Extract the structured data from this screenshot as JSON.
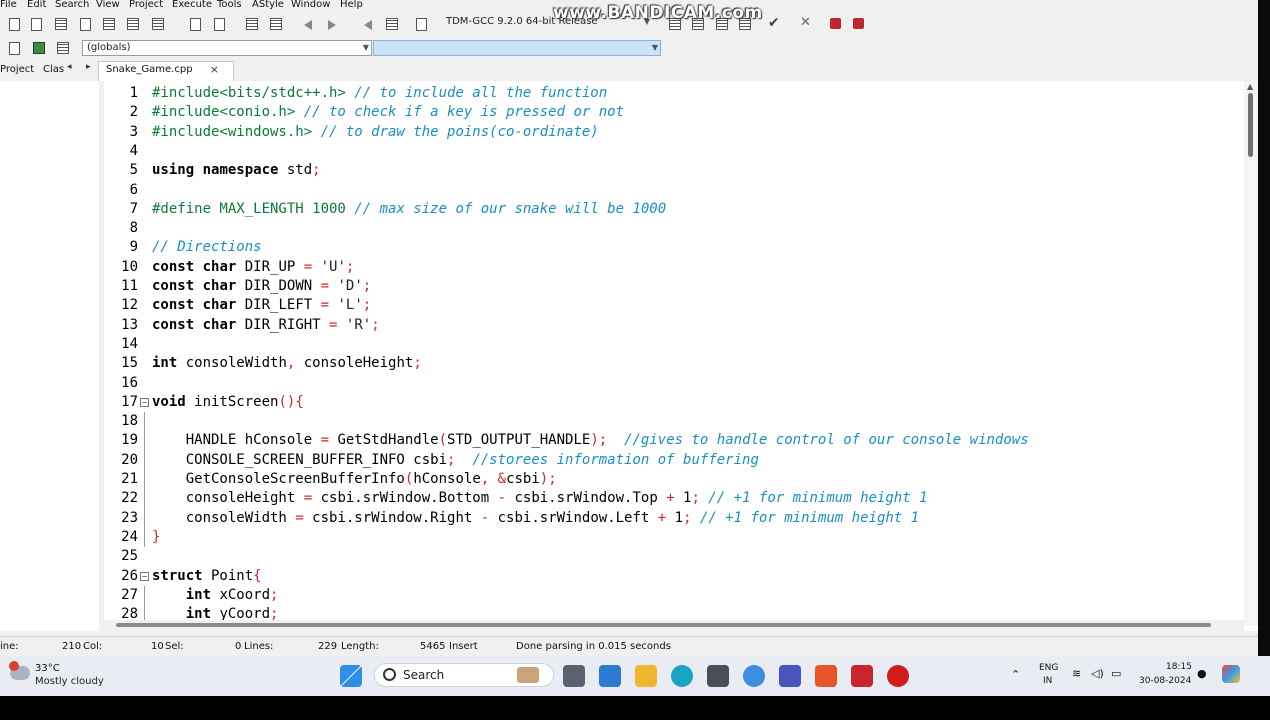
{
  "menu": [
    "File",
    "Edit",
    "Search",
    "View",
    "Project",
    "Execute",
    "Tools",
    "AStyle",
    "Window",
    "Help"
  ],
  "toolbar": {
    "compiler": "TDM-GCC 9.2.0 64-bit Release",
    "scope": "(globals)",
    "watermark": "www.BANDICAM.com"
  },
  "panel_tabs": {
    "project": "Project",
    "classes": "Clas"
  },
  "file_tab": {
    "name": "Snake_Game.cpp",
    "close": "×"
  },
  "editor": {
    "lines": [
      {
        "n": "1",
        "text": "#include<bits/stdc++.h> // to include all the function"
      },
      {
        "n": "2",
        "text": "#include<conio.h> // to check if a key is pressed or not"
      },
      {
        "n": "3",
        "text": "#include<windows.h> // to draw the poins(co-ordinate)"
      },
      {
        "n": "4",
        "text": ""
      },
      {
        "n": "5",
        "text": "using namespace std;"
      },
      {
        "n": "6",
        "text": ""
      },
      {
        "n": "7",
        "text": "#define MAX_LENGTH 1000 // max size of our snake will be 1000"
      },
      {
        "n": "8",
        "text": ""
      },
      {
        "n": "9",
        "text": "// Directions"
      },
      {
        "n": "10",
        "text": "const char DIR_UP = 'U';"
      },
      {
        "n": "11",
        "text": "const char DIR_DOWN = 'D';"
      },
      {
        "n": "12",
        "text": "const char DIR_LEFT = 'L';"
      },
      {
        "n": "13",
        "text": "const char DIR_RIGHT = 'R';"
      },
      {
        "n": "14",
        "text": ""
      },
      {
        "n": "15",
        "text": "int consoleWidth, consoleHeight;"
      },
      {
        "n": "16",
        "text": ""
      },
      {
        "n": "17",
        "text": "void initScreen(){"
      },
      {
        "n": "18",
        "text": ""
      },
      {
        "n": "19",
        "text": "    HANDLE hConsole = GetStdHandle(STD_OUTPUT_HANDLE);  //gives to handle control of our console windows"
      },
      {
        "n": "20",
        "text": "    CONSOLE_SCREEN_BUFFER_INFO csbi;  //storees information of buffering"
      },
      {
        "n": "21",
        "text": "    GetConsoleScreenBufferInfo(hConsole, &csbi);"
      },
      {
        "n": "22",
        "text": "    consoleHeight = csbi.srWindow.Bottom - csbi.srWindow.Top + 1; // +1 for minimum height 1"
      },
      {
        "n": "23",
        "text": "    consoleWidth = csbi.srWindow.Right - csbi.srWindow.Left + 1; // +1 for minimum height 1"
      },
      {
        "n": "24",
        "text": "}"
      },
      {
        "n": "25",
        "text": ""
      },
      {
        "n": "26",
        "text": "struct Point{"
      },
      {
        "n": "27",
        "text": "    int xCoord;"
      },
      {
        "n": "28",
        "text": "    int yCoord;"
      }
    ]
  },
  "status": {
    "line_label": "ine:",
    "line_val": "210",
    "col_label": "Col:",
    "col_val": "10",
    "sel_label": "Sel:",
    "sel_val": "0",
    "lines_label": "Lines:",
    "lines_val": "229",
    "length_label": "Length:",
    "length_val": "5465",
    "mode": "Insert",
    "message": "Done parsing in 0.015 seconds"
  },
  "taskbar": {
    "weather_temp": "33°C",
    "weather_desc": "Mostly cloudy",
    "search_label": "Search",
    "lang1": "ENG",
    "lang2": "IN",
    "time": "18:15",
    "date": "30-08-2024"
  }
}
